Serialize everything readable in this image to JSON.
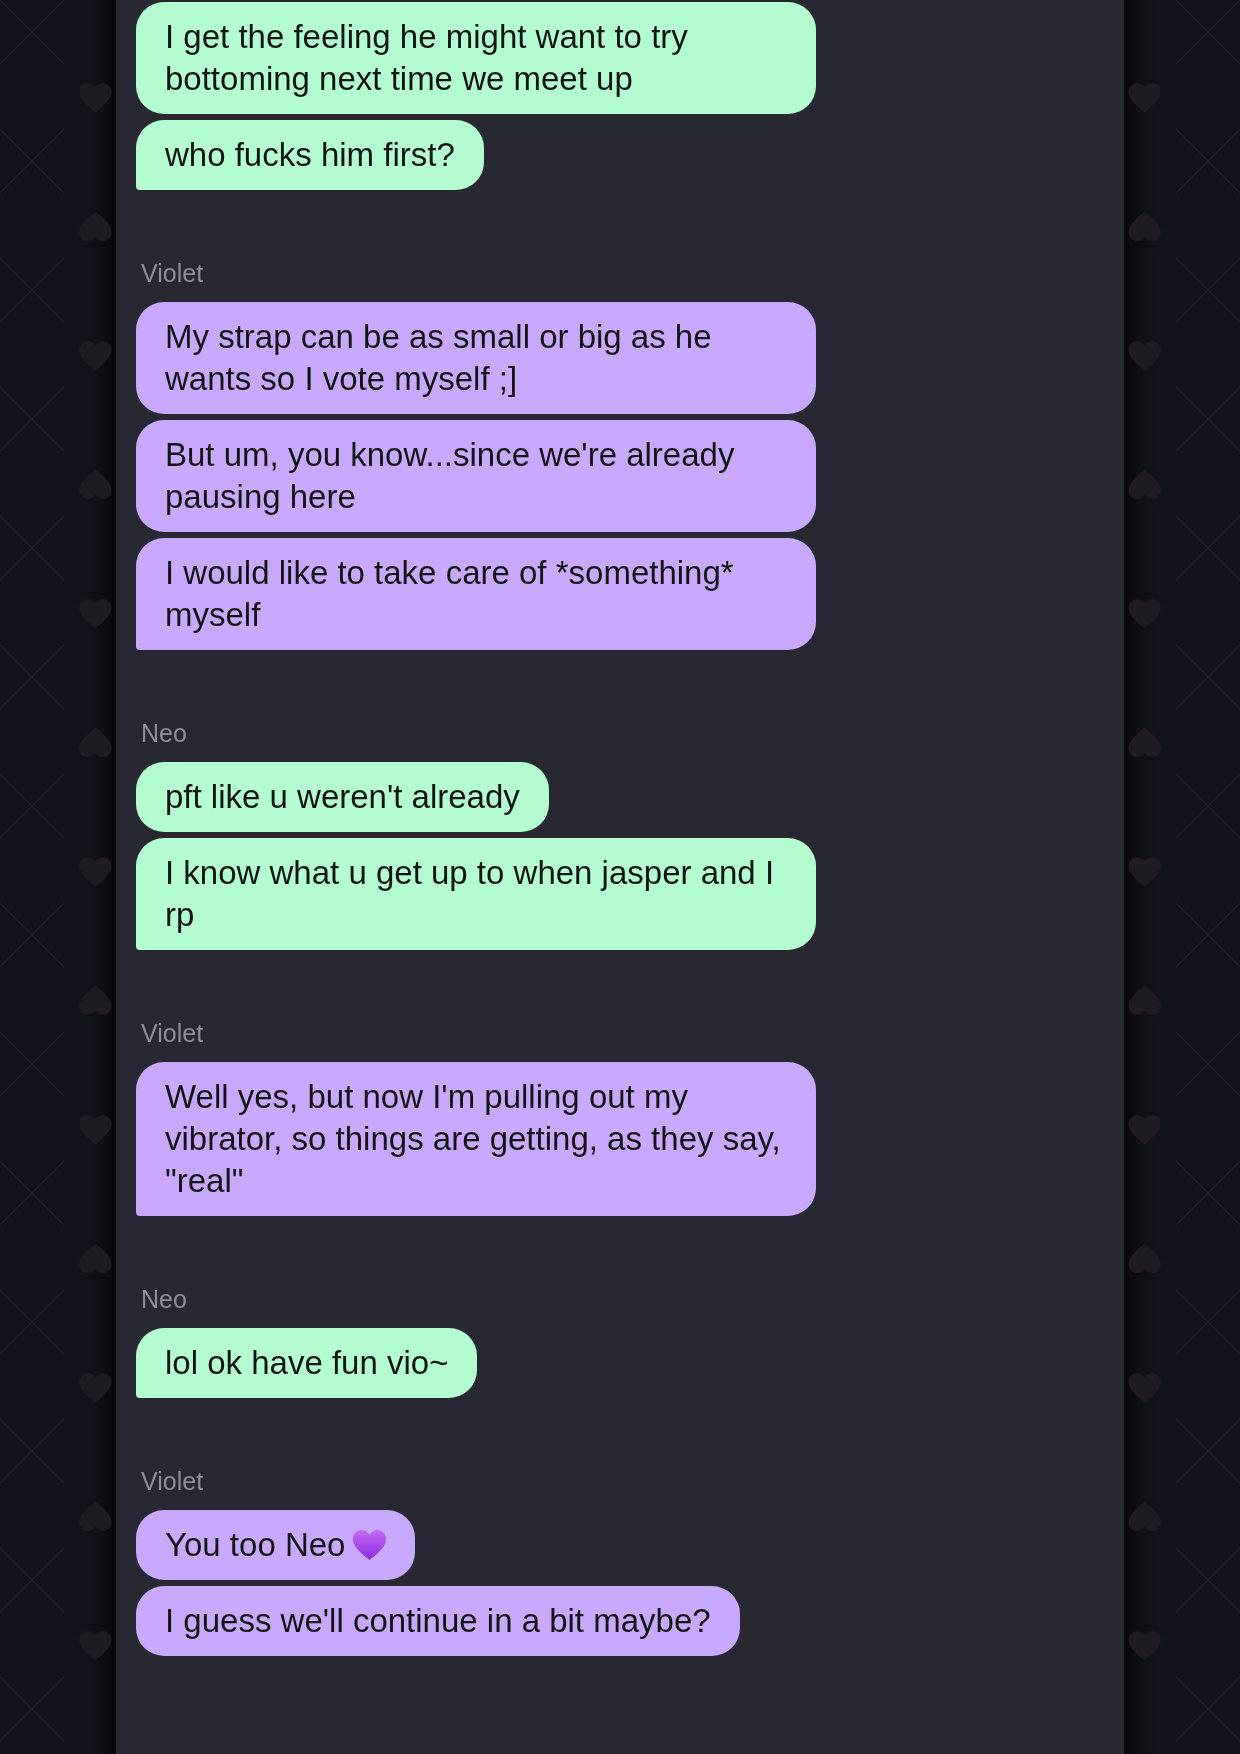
{
  "conversation": {
    "groups": [
      {
        "color": "#b3fdd0",
        "messages": [
          {
            "text": "I get the feeling he might want to try bottoming next time we meet up",
            "tail": false
          },
          {
            "text": "who fucks him first?",
            "tail": true
          }
        ]
      },
      {
        "sender": "Violet",
        "color": "#c8a9fe",
        "messages": [
          {
            "text": "My strap can be as small or big as he wants so I vote myself ;]",
            "tail": false
          },
          {
            "text": "But um, you know...since we're already pausing here",
            "tail": false
          },
          {
            "text": "I would like to take care of *something* myself",
            "tail": true
          }
        ]
      },
      {
        "sender": "Neo",
        "color": "#b3fdd0",
        "messages": [
          {
            "text": "pft like u weren't already",
            "tail": false
          },
          {
            "text": "I know what u get up to when jasper and I rp",
            "tail": true
          }
        ]
      },
      {
        "sender": "Violet",
        "color": "#c8a9fe",
        "messages": [
          {
            "text": "Well yes, but now I'm pulling out my vibrator, so things are getting, as they say, \"real\"",
            "tail": true
          }
        ]
      },
      {
        "sender": "Neo",
        "color": "#b3fdd0",
        "messages": [
          {
            "text": "lol ok have fun vio~",
            "tail": true
          }
        ]
      },
      {
        "sender": "Violet",
        "color": "#c8a9fe",
        "messages": [
          {
            "text": "You too Neo",
            "emoji": true,
            "tail": false
          },
          {
            "text": "I guess we'll continue in a bit maybe?",
            "tail": false
          }
        ]
      }
    ]
  }
}
